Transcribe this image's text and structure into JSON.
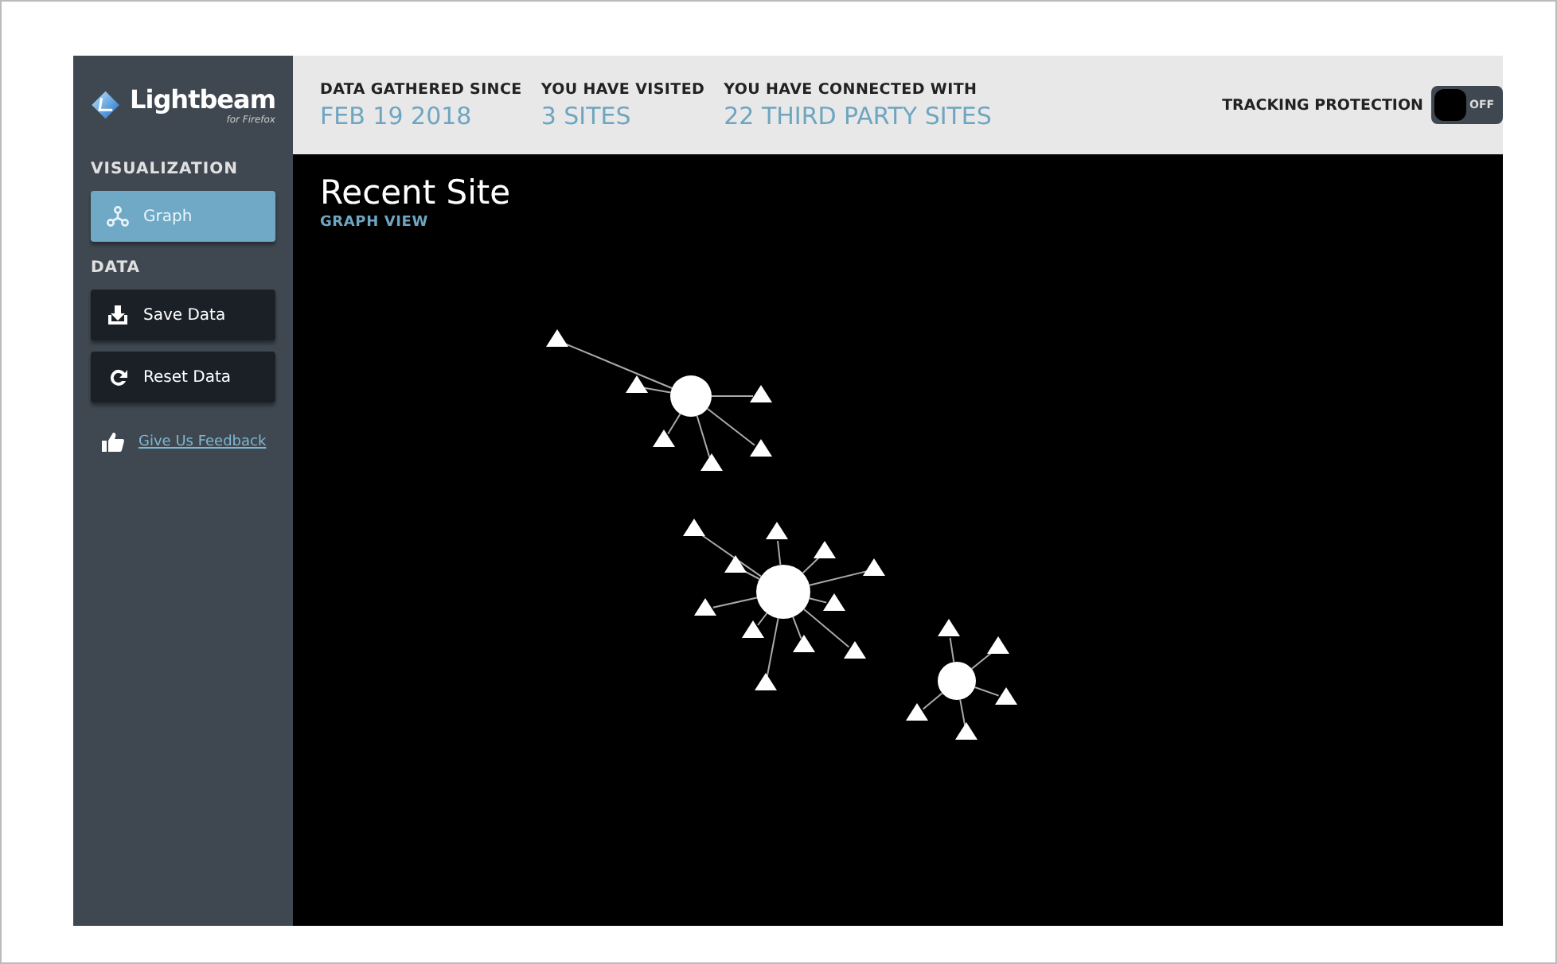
{
  "sidebar": {
    "logo": {
      "name": "Lightbeam",
      "subtitle": "for Firefox"
    },
    "sections": [
      {
        "heading": "VISUALIZATION",
        "buttons": [
          {
            "label": "Graph",
            "selected": true
          }
        ]
      },
      {
        "heading": "DATA",
        "buttons": [
          {
            "label": "Save Data",
            "selected": false
          },
          {
            "label": "Reset Data",
            "selected": false
          }
        ]
      }
    ],
    "feedback_link": "Give Us Feedback"
  },
  "header": {
    "stats": [
      {
        "label": "DATA GATHERED SINCE",
        "value": "FEB 19 2018"
      },
      {
        "label": "YOU HAVE VISITED",
        "value": "3 SITES"
      },
      {
        "label": "YOU HAVE CONNECTED WITH",
        "value": "22 THIRD PARTY SITES"
      }
    ],
    "tracking_protection": {
      "label": "TRACKING PROTECTION",
      "on": false,
      "state_text": "OFF"
    }
  },
  "main": {
    "title": "Recent Site",
    "subtitle": "GRAPH VIEW"
  }
}
